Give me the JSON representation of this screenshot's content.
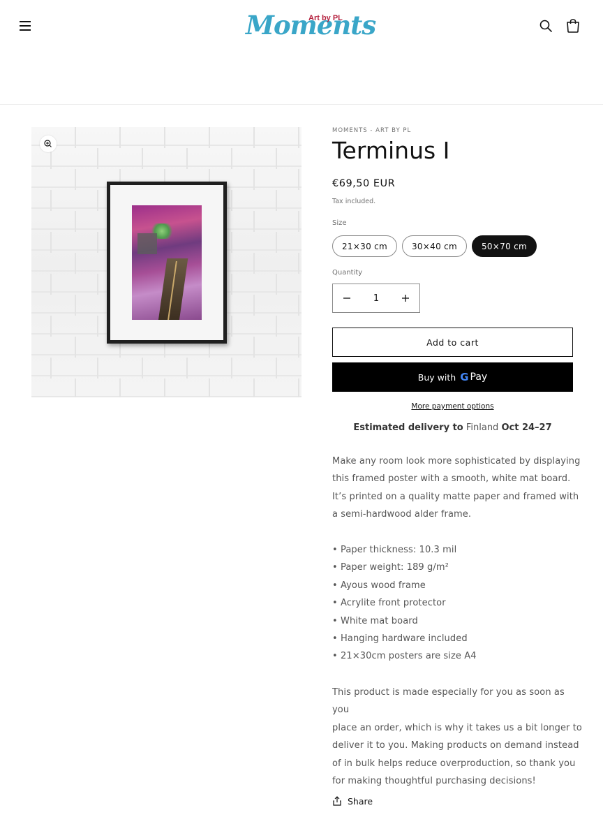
{
  "header": {
    "logo_main": "Moments",
    "logo_sub": "Art by PL",
    "menu_icon": "hamburger-menu-icon",
    "search_icon": "search-icon",
    "cart_icon": "cart-icon"
  },
  "product": {
    "vendor": "MOMENTS - ART BY PL",
    "title": "Terminus I",
    "price": "€69,50 EUR",
    "tax_note": "Tax included.",
    "size_label": "Size",
    "sizes": [
      "21×30 cm",
      "30×40 cm",
      "50×70 cm"
    ],
    "selected_size": "50×70 cm",
    "quantity_label": "Quantity",
    "quantity": "1",
    "add_to_cart": "Add to cart",
    "buy_with": "Buy with",
    "gpay_g": "G",
    "gpay_pay": "Pay",
    "more_payment": "More payment options",
    "delivery_prefix": "Estimated delivery to",
    "delivery_country": "Finland",
    "delivery_dates": "Oct 24–27",
    "description_lines": [
      "Make any room look more sophisticated by displaying",
      "this framed poster with a smooth, white mat board.",
      "It’s printed on a quality matte paper and framed with",
      "a semi-hardwood alder frame."
    ],
    "features": [
      "• Paper thickness: 10.3 mil",
      "• Paper weight: 189 g/m²",
      "• Ayous wood frame",
      "• Acrylite front protector",
      "• White mat board",
      "• Hanging hardware included",
      "• 21×30cm posters are size A4"
    ],
    "on_demand_lines": [
      "This product is made especially for you as soon as you",
      "place an order, which is why it takes us a bit longer to",
      "deliver it to you. Making products on demand instead",
      "of in bulk helps reduce overproduction, so thank you",
      "for making thoughtful purchasing decisions!"
    ],
    "share": "Share"
  },
  "colors": {
    "logo_blue": "#3aa6c8",
    "logo_red": "#b5223f",
    "active_pill": "#121212"
  }
}
